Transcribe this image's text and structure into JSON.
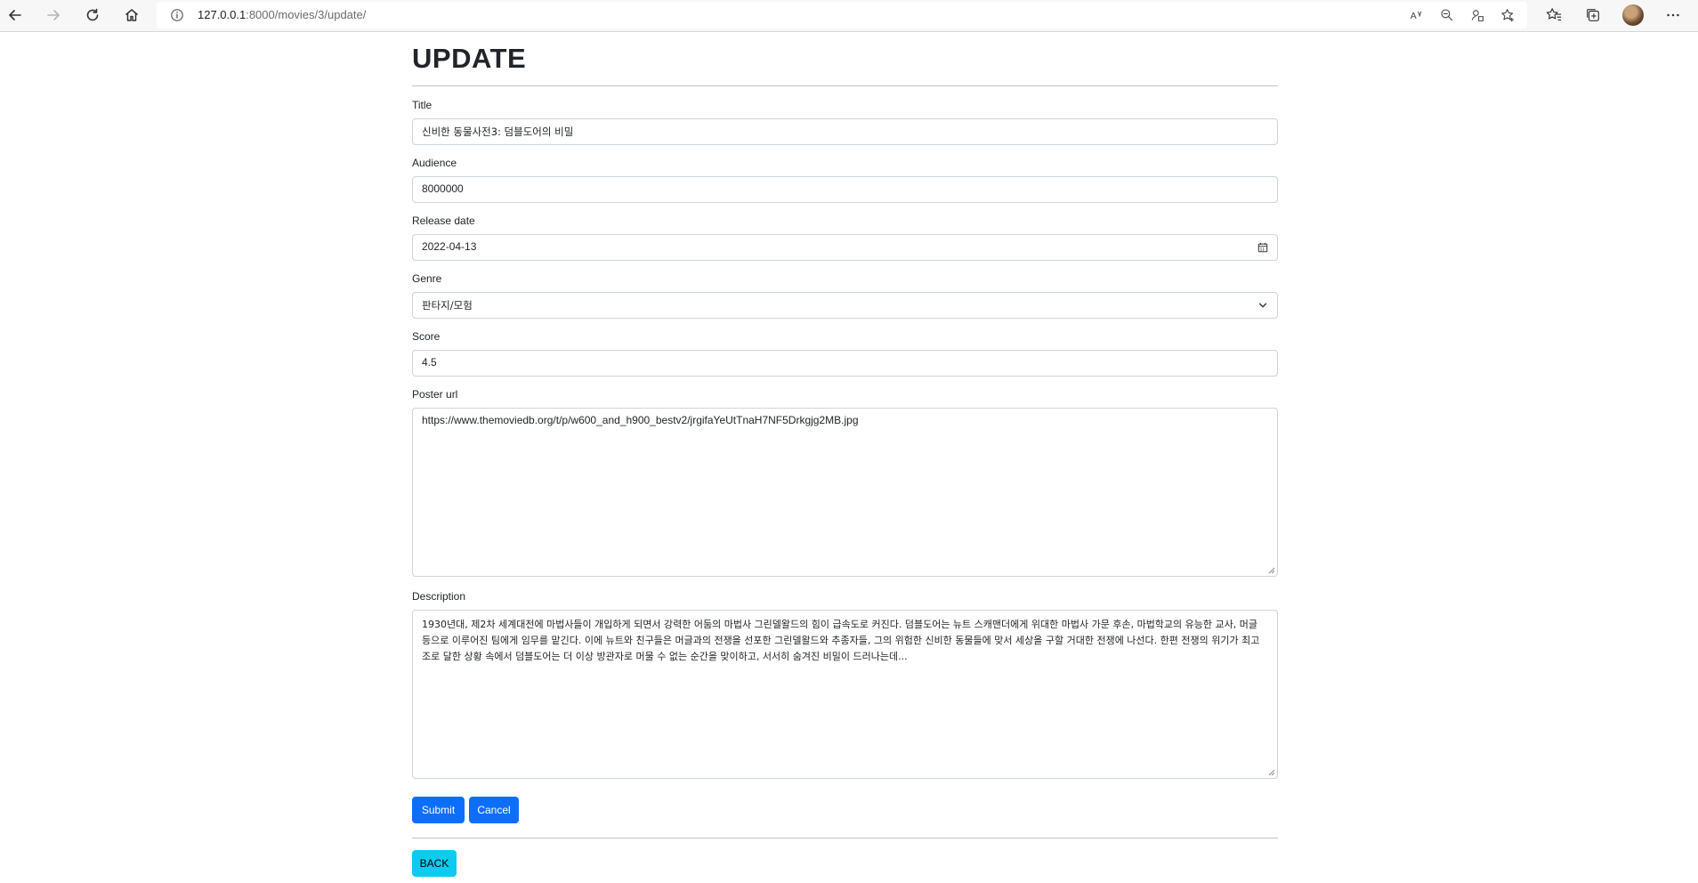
{
  "browser": {
    "url_host": "127.0.0.1",
    "url_path": ":8000/movies/3/update/"
  },
  "page": {
    "title": "UPDATE"
  },
  "form": {
    "title": {
      "label": "Title",
      "value": "신비한 동물사전3: 덤블도어의 비밀"
    },
    "audience": {
      "label": "Audience",
      "value": "8000000"
    },
    "release_date": {
      "label": "Release date",
      "value": "2022-04-13"
    },
    "genre": {
      "label": "Genre",
      "value": "판타지/모험"
    },
    "score": {
      "label": "Score",
      "value": "4.5"
    },
    "poster_url": {
      "label": "Poster url",
      "value": "https://www.themoviedb.org/t/p/w600_and_h900_bestv2/jrgifaYeUtTnaH7NF5Drkgjg2MB.jpg"
    },
    "description": {
      "label": "Description",
      "value": "1930년대, 제2차 세계대전에 마법사들이 개입하게 되면서 강력한 어둠의 마법사 그린델왈드의 힘이 급속도로 커진다. 덤블도어는 뉴트 스캐맨더에게 위대한 마법사 가문 후손, 마법학교의 유능한 교사, 머글 등으로 이루어진 팀에게 임무를 맡긴다. 이에 뉴트와 친구들은 머글과의 전쟁을 선포한 그린델왈드와 추종자들, 그의 위험한 신비한 동물들에 맞서 세상을 구할 거대한 전쟁에 나선다. 한편 전쟁의 위기가 최고조로 달한 상황 속에서 덤블도어는 더 이상 방관자로 머물 수 없는 순간을 맞이하고, 서서히 숨겨진 비밀이 드러나는데..."
    }
  },
  "buttons": {
    "submit": "Submit",
    "cancel": "Cancel",
    "back": "BACK"
  }
}
